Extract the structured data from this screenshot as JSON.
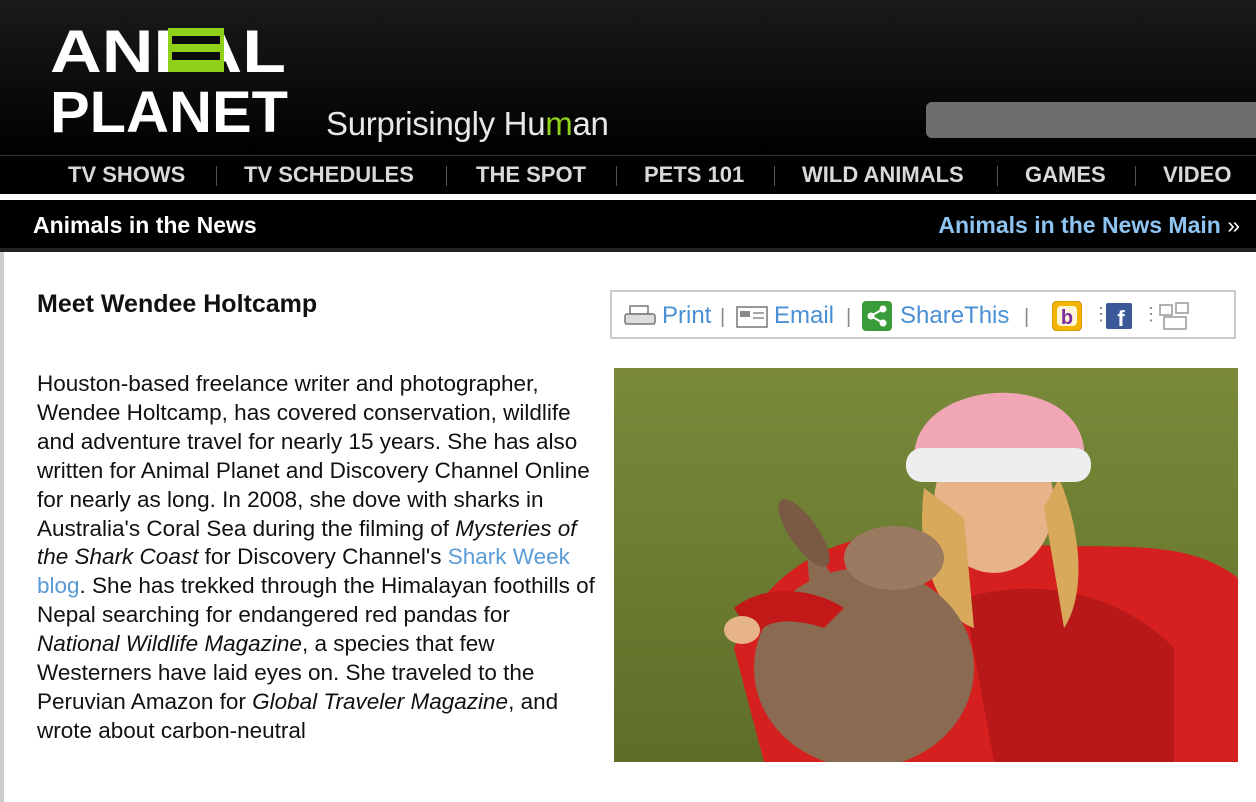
{
  "brand": {
    "logo_line1": "ANIMAL",
    "logo_line2": "PLANET",
    "tagline_pre": "Surprisingly Hu",
    "tagline_m": "m",
    "tagline_post": "an"
  },
  "nav": {
    "items": [
      "TV SHOWS",
      "TV SCHEDULES",
      "THE SPOT",
      "PETS 101",
      "WILD ANIMALS",
      "GAMES",
      "VIDEO"
    ]
  },
  "section": {
    "title": "Animals in the News",
    "main_link": "Animals in the News Main",
    "main_arrow": "»"
  },
  "article": {
    "headline": "Meet Wendee Holtcamp",
    "p_plain_1": "Houston-based freelance writer and photographer, Wendee Holtcamp, has covered conservation, wildlife and adventure travel for nearly 15 years. She has also written for Animal Planet and Discovery Channel Online for nearly as long. In 2008, she dove with sharks in Australia's Coral Sea during the filming of ",
    "p_italic_1": "Mysteries of the Shark Coast ",
    "p_plain_2": " for Discovery Channel's ",
    "p_link_1": "Shark Week blog",
    "p_plain_3": ". She has trekked through the Himalayan foothills of Nepal searching for endangered red pandas for ",
    "p_italic_2": "National Wildlife Magazine",
    "p_plain_4": ", a species that few Westerners have laid eyes on. She traveled to the Peruvian Amazon for ",
    "p_italic_3": "Global Traveler Magazine",
    "p_plain_5": ", and wrote about carbon-neutral"
  },
  "share": {
    "print": "Print",
    "email": "Email",
    "sharethis": "ShareThis",
    "pipe": "|"
  },
  "colors": {
    "accent_green": "#8fd118",
    "link_blue": "#5a9bd6",
    "header_bg": "#000000"
  }
}
